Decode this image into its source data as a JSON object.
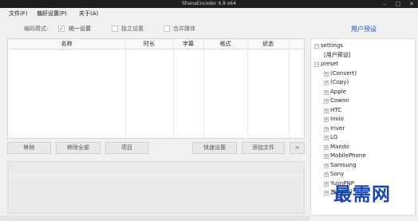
{
  "window": {
    "title": "ShanaEncoder 4.9 x64"
  },
  "menu": [
    {
      "label": "文件(F)"
    },
    {
      "label": "偏好设置(P)"
    },
    {
      "label": "关于(A)"
    }
  ],
  "options": {
    "mode_label": "编码模式:",
    "unified": {
      "label": "统一设置",
      "checked": true
    },
    "independent": {
      "label": "独立设置",
      "checked": false
    },
    "merge": {
      "label": "合并媒体",
      "checked": false
    }
  },
  "table": {
    "columns": [
      "名称",
      "时长",
      "字幕",
      "格式",
      "状态"
    ]
  },
  "buttons": {
    "remove": "移除",
    "remove_all": "移除全部",
    "item": "项目",
    "quick_settings": "快速设置",
    "add_file": "添加文件",
    "more": ">"
  },
  "preset_panel": {
    "title": "用户预设",
    "tree": [
      {
        "label": "settings",
        "expander": "⊟",
        "level": 0
      },
      {
        "label": "[用户预设]",
        "expander": "",
        "level": 1
      },
      {
        "label": "preset",
        "expander": "⊟",
        "level": 0
      },
      {
        "label": "(Convert)",
        "expander": "⊞",
        "level": 1
      },
      {
        "label": "(Copy)",
        "expander": "⊞",
        "level": 1
      },
      {
        "label": "Apple",
        "expander": "⊞",
        "level": 1
      },
      {
        "label": "Cowon",
        "expander": "⊞",
        "level": 1
      },
      {
        "label": "HTC",
        "expander": "⊞",
        "level": 1
      },
      {
        "label": "Invio",
        "expander": "⊞",
        "level": 1
      },
      {
        "label": "Iriver",
        "expander": "⊞",
        "level": 1
      },
      {
        "label": "LG",
        "expander": "⊞",
        "level": 1
      },
      {
        "label": "Mando",
        "expander": "⊞",
        "level": 1
      },
      {
        "label": "MobilePhone",
        "expander": "⊞",
        "level": 1
      },
      {
        "label": "Samsung",
        "expander": "⊞",
        "level": 1
      },
      {
        "label": "Sony",
        "expander": "⊞",
        "level": 1
      },
      {
        "label": "YujinPNP",
        "expander": "⊞",
        "level": 1
      },
      {
        "label": "其他预设",
        "expander": "⊞",
        "level": 1
      }
    ]
  },
  "watermark": {
    "text": "最需网"
  },
  "colors": {
    "titlebar": "#1f1f1f",
    "accent": "#2050c0",
    "check": "#d04040",
    "watermark": "#1844b0"
  }
}
